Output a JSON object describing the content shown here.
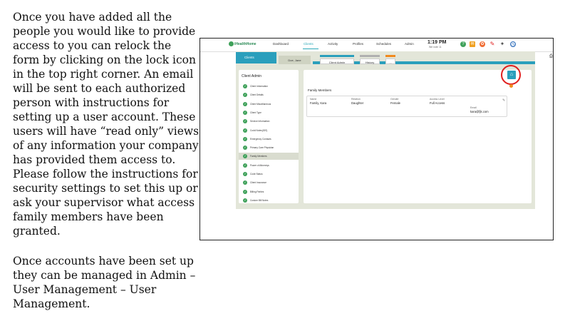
{
  "instructions": {
    "paragraph1": "Once you have added all the people you would like to provide access to you can relock the form by clicking on the lock icon in the top right corner. An email will be sent to each authorized person with instructions for setting up a user account. These users will have “read only” views of any information your company has provided them access to. Please follow the instructions for security settings to set this up or ask your supervisor what access family members have been granted.",
    "paragraph2": "Once accounts have been set up they can be managed in Admin – User Management – User Management."
  },
  "app": {
    "logo": "iHealthHome",
    "nav": [
      "Dashboard",
      "Clients",
      "Activity",
      "Profiles",
      "Schedules",
      "Admin"
    ],
    "active_nav": "Clients",
    "time": "1:19 PM",
    "subtime": "We note 11",
    "top_icons": [
      "help-icon",
      "mail-icon",
      "butterfly-icon",
      "pencil-icon",
      "pin-icon",
      "clock-icon"
    ]
  },
  "client": {
    "tab_label": "Clients",
    "name": "Doe, Jane",
    "subtabs": [
      "Client Admin",
      "History",
      "..."
    ],
    "subtab_colors": [
      "#2a9fbc",
      "#b0b0b0",
      "#f08a1e"
    ]
  },
  "sidebar": {
    "title": "Client Admin",
    "items": [
      "Client Information",
      "Client Details",
      "Client Miscellaneous",
      "Client Type",
      "Service Information",
      "Codd Notes(IDS)",
      "Emergency Contacts",
      "Primary Care Physician",
      "Family Members",
      "Power of Attorneys",
      "Code Status",
      "Client Insurance",
      "Billing Parties",
      "Custom Bill Notes"
    ],
    "selected": "Family Members"
  },
  "family": {
    "title": "Family Members",
    "headers": {
      "name": "Name",
      "relation": "Relation",
      "gender": "Gender",
      "access": "Access Level",
      "email": "Email"
    },
    "member": {
      "name": "Family, Kara",
      "relation": "Daughter",
      "gender": "Female",
      "access": "Full Access",
      "email": "kara@fjk.com"
    }
  },
  "colors": {
    "accent": "#2a9fbc",
    "highlight_circle": "#e01e1e",
    "check": "#3fa15a"
  }
}
